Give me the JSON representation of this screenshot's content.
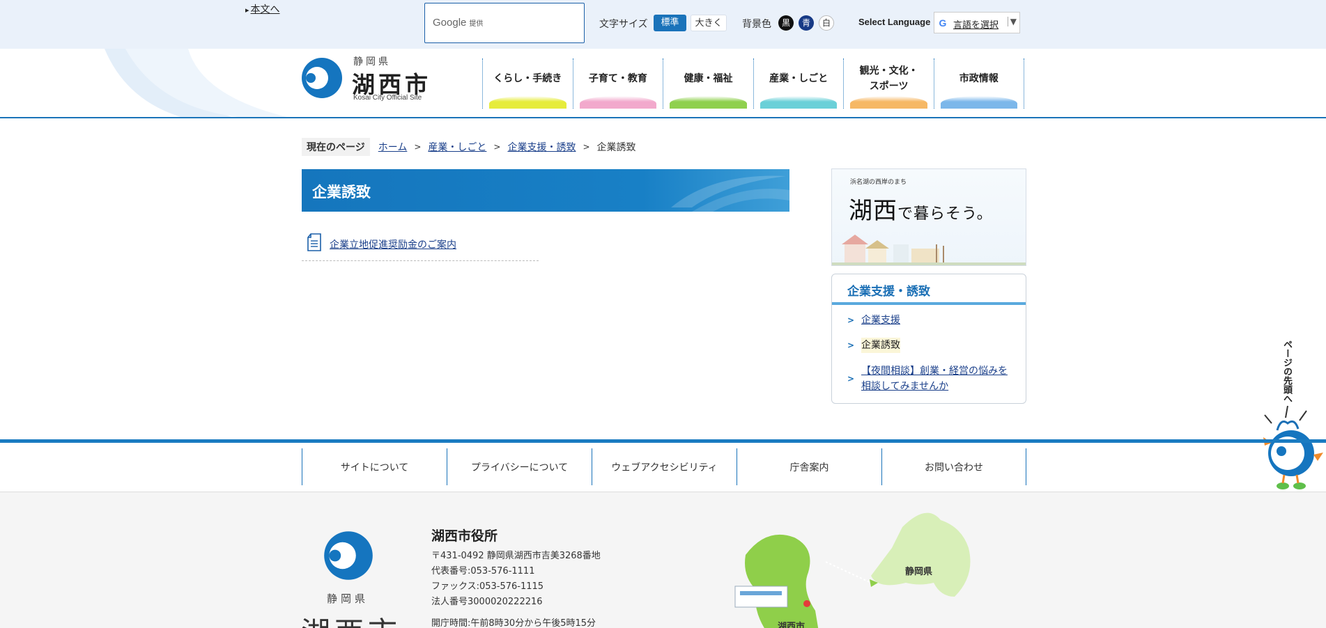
{
  "topbar": {
    "skip_link": "本文へ",
    "search": {
      "google_label": "Google",
      "provided_label": "提供"
    },
    "font_size_label": "文字サイズ",
    "font_size_standard": "標準",
    "font_size_large": "大きく",
    "bg_color_label": "背景色",
    "bg_black": "黒",
    "bg_blue": "青",
    "bg_white": "白",
    "language_label": "Select Language",
    "language_select": "言語を選択",
    "language_caret": "▼"
  },
  "header": {
    "logo_pref": "静岡県",
    "logo_city": "湖西市",
    "logo_en": "Kosai City Official Site",
    "nav": [
      {
        "label": "くらし・手続き",
        "color": "#e6ec3c"
      },
      {
        "label": "子育て・教育",
        "color": "#f2a9cc"
      },
      {
        "label": "健康・福祉",
        "color": "#8fd04e"
      },
      {
        "label": "産業・しごと",
        "color": "#6ad0d8"
      },
      {
        "label": "観光・文化・\nスポーツ",
        "color": "#f6b865"
      },
      {
        "label": "市政情報",
        "color": "#7cb7ea"
      }
    ]
  },
  "breadcrumb": {
    "here_label": "現在のページ",
    "items": [
      "ホーム",
      "産業・しごと",
      "企業支援・誘致"
    ],
    "current": "企業誘致"
  },
  "main": {
    "title": "企業誘致",
    "links": [
      "企業立地促進奨励金のご案内"
    ]
  },
  "sidebar": {
    "banner_small": "浜名湖の西岸のまち",
    "banner_main": "湖西",
    "banner_tail": "で暮らそう。",
    "box_title": "企業支援・誘致",
    "items": [
      {
        "label": "企業支援",
        "current": false
      },
      {
        "label": "企業誘致",
        "current": true
      },
      {
        "label": "【夜間相談】創業・経営の悩みを",
        "label2": "相談してみませんか",
        "current": false
      }
    ]
  },
  "pagetop": {
    "label": "ページの先頭へ"
  },
  "footer_nav": [
    "サイトについて",
    "プライバシーについて",
    "ウェブアクセシビリティ",
    "庁舎案内",
    "お問い合わせ"
  ],
  "footer": {
    "logo_pref": "静岡県",
    "logo_city": "湖西市",
    "office_name": "湖西市役所",
    "address": "〒431-0492 静岡県湖西市吉美3268番地",
    "phone": "代表番号:053-576-1111",
    "fax": "ファックス:053-576-1115",
    "corp_number": "法人番号3000020222216",
    "hours": "開庁時間:午前8時30分から午後5時15分",
    "map_pref_label": "静岡県",
    "map_city_label": "湖西市"
  },
  "colors": {
    "primary": "#1a73ba",
    "link": "#1a3f8a"
  }
}
